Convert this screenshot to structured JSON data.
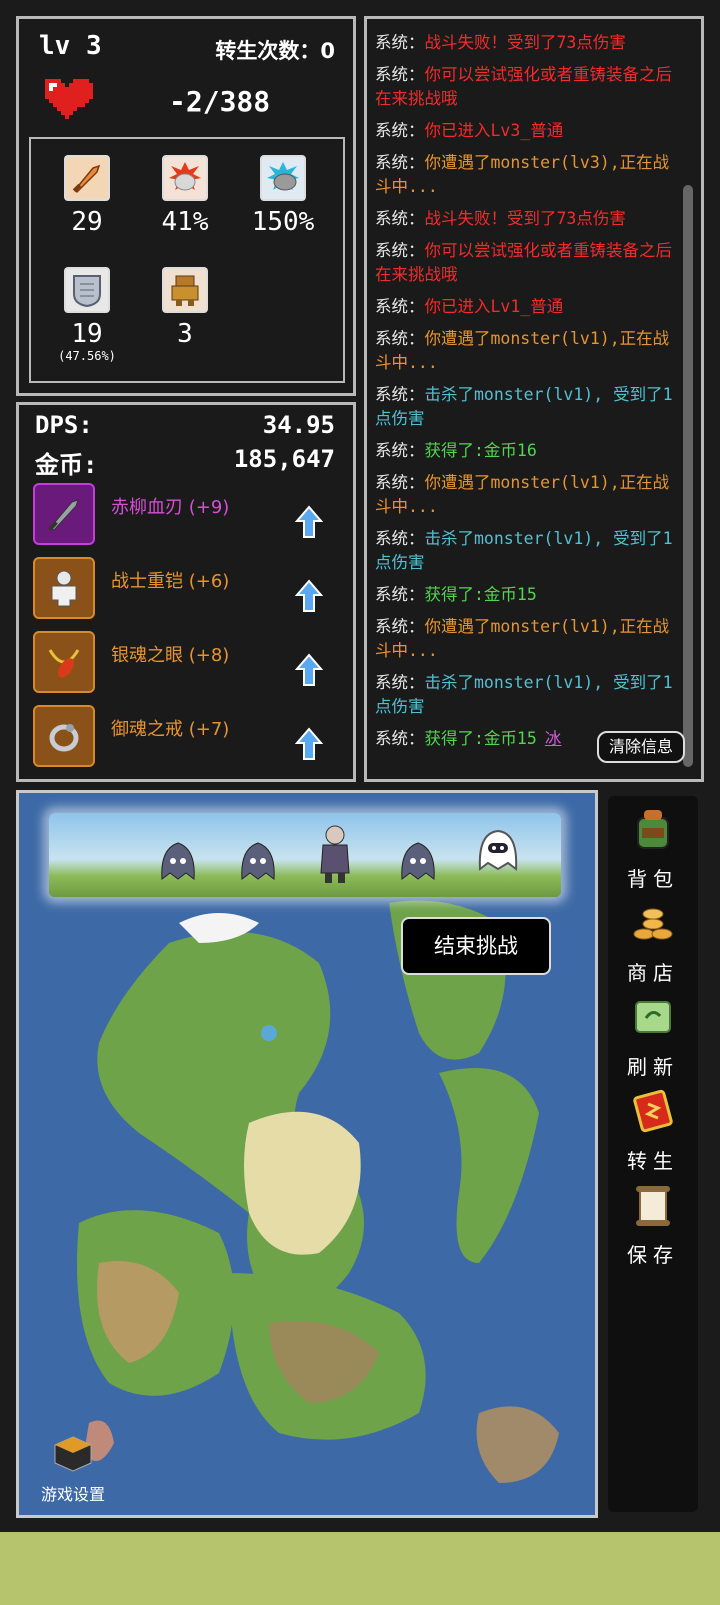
{
  "stats": {
    "level": "lv 3",
    "rebirth_label": "转生次数：0",
    "hp": "-2/388",
    "attrs": [
      {
        "icon": "sword-icon",
        "value": "29",
        "sub": ""
      },
      {
        "icon": "fist-crit-icon",
        "value": "41%",
        "sub": ""
      },
      {
        "icon": "fist-crit-damage-icon",
        "value": "150%",
        "sub": ""
      },
      {
        "icon": "shield-icon",
        "value": "19",
        "sub": "(47.56%)"
      },
      {
        "icon": "golem-icon",
        "value": "3",
        "sub": ""
      }
    ]
  },
  "equip": {
    "dps_label": "DPS:",
    "dps_value": "34.95",
    "gold_label": "金币:",
    "gold_value": "185,647",
    "items": [
      {
        "name": "赤柳血刃 (+9)",
        "color": "#d64fd6",
        "icon": "dagger-icon",
        "frame": "#7a1a8a"
      },
      {
        "name": "战士重铠 (+6)",
        "color": "#e8942e",
        "icon": "armor-icon",
        "frame": "#7a4a16"
      },
      {
        "name": "银魂之眼 (+8)",
        "color": "#e8942e",
        "icon": "amulet-icon",
        "frame": "#7a4a16"
      },
      {
        "name": "御魂之戒 (+7)",
        "color": "#e8942e",
        "icon": "ring-icon",
        "frame": "#7a4a16"
      }
    ]
  },
  "log": {
    "prefix": "系统：",
    "entries": [
      {
        "text": "战斗失败！受到了73点伤害",
        "cls": "c-red"
      },
      {
        "text": "你可以尝试强化或者重铸装备之后在来挑战哦",
        "cls": "c-red"
      },
      {
        "text": "你已进入Lv3_普通",
        "cls": "c-red"
      },
      {
        "text": "你遭遇了monster(lv3),正在战斗中...",
        "cls": "c-orange"
      },
      {
        "text": "战斗失败！受到了73点伤害",
        "cls": "c-red"
      },
      {
        "text": "你可以尝试强化或者重铸装备之后在来挑战哦",
        "cls": "c-red"
      },
      {
        "text": "你已进入Lv1_普通",
        "cls": "c-red"
      },
      {
        "text": "你遭遇了monster(lv1),正在战斗中...",
        "cls": "c-orange"
      },
      {
        "text": "击杀了monster(lv1), 受到了1点伤害",
        "cls": "c-cyan"
      },
      {
        "text": "获得了:金币16",
        "cls": "c-green"
      },
      {
        "text": "你遭遇了monster(lv1),正在战斗中...",
        "cls": "c-orange"
      },
      {
        "text": "击杀了monster(lv1), 受到了1点伤害",
        "cls": "c-cyan"
      },
      {
        "text": "获得了:金币15",
        "cls": "c-green"
      },
      {
        "text": "你遭遇了monster(lv1),正在战斗中...",
        "cls": "c-orange"
      },
      {
        "text": "击杀了monster(lv1), 受到了1点伤害",
        "cls": "c-cyan"
      },
      {
        "text": "获得了:金币15",
        "cls": "c-green",
        "extra": "冰"
      }
    ],
    "clear_label": "清除信息"
  },
  "map": {
    "end_challenge_label": "结束挑战",
    "settings_label": "游戏设置"
  },
  "sidebar": {
    "items": [
      {
        "label": "背包",
        "icon": "backpack-icon"
      },
      {
        "label": "商店",
        "icon": "coins-shop-icon"
      },
      {
        "label": "刷新",
        "icon": "scroll-refresh-icon"
      },
      {
        "label": "转生",
        "icon": "rebirth-card-icon"
      },
      {
        "label": "保存",
        "icon": "save-scroll-icon"
      }
    ]
  }
}
